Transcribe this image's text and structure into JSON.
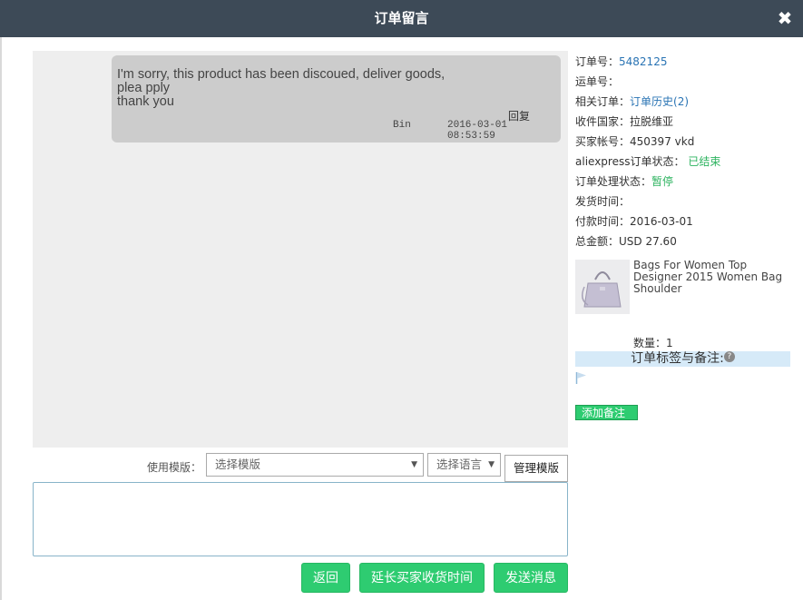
{
  "dialog": {
    "title": "订单留言",
    "close_glyph": "✖"
  },
  "message": {
    "lines": [
      "I'm sorry, this product has been discoued, deliver goods,",
      "plea pply",
      "thank you"
    ],
    "reply_label": "回复",
    "sender": "Bin",
    "time": "2016-03-01 08:53:59"
  },
  "composer": {
    "template_label": "使用模版：",
    "template_select": "选择模版",
    "language_select": "选择语言",
    "manage_button": "管理模版",
    "textarea_value": ""
  },
  "actions": {
    "back": "返回",
    "extend": "延长买家收货时间",
    "send": "发送消息"
  },
  "order": {
    "order_no_label": "订单号：",
    "order_no": "5482125",
    "tracking_label": "运单号：",
    "related_label": "相关订单：",
    "related_link": "订单历史(2)",
    "country_label": "收件国家：",
    "country": "拉脱维亚",
    "buyer_label": "买家帐号：",
    "buyer": "450397 vkd",
    "ae_status_label": "aliexpress订单状态：",
    "ae_status": "已结束",
    "proc_status_label": "订单处理状态：",
    "proc_status": "暂停",
    "ship_time_label": "发货时间：",
    "pay_time_label": "付款时间：",
    "pay_time": "2016-03-01",
    "total_label": "总金额：",
    "total": "USD 27.60",
    "product_name": "Bags For Women Top Designer 2015 Women Bag Shoulder",
    "quantity_label": "数量：",
    "quantity": "1",
    "tags_heading": "订单标签与备注:",
    "add_note_button": "添加备注"
  },
  "colors": {
    "titlebar": "#3d4a57",
    "accent_green": "#2ecc71",
    "link_blue": "#2a74b4"
  }
}
